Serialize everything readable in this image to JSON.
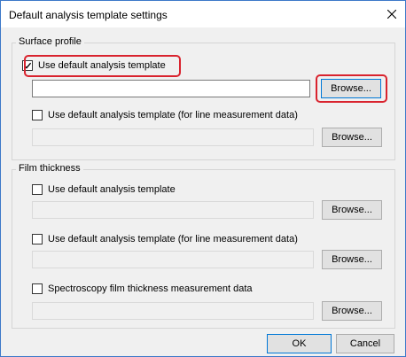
{
  "dialog": {
    "title": "Default analysis template settings",
    "close_icon": "close-icon"
  },
  "surface_profile": {
    "legend": "Surface profile",
    "default_template": {
      "checked": true,
      "label": "Use default analysis template",
      "path_value": "",
      "browse_label": "Browse..."
    },
    "line_template": {
      "checked": false,
      "label": "Use default analysis template (for line measurement data)",
      "path_value": "",
      "browse_label": "Browse..."
    }
  },
  "film_thickness": {
    "legend": "Film thickness",
    "default_template": {
      "checked": false,
      "label": "Use default analysis template",
      "path_value": "",
      "browse_label": "Browse..."
    },
    "line_template": {
      "checked": false,
      "label": "Use default analysis template (for line measurement data)",
      "path_value": "",
      "browse_label": "Browse..."
    },
    "spectroscopy": {
      "checked": false,
      "label": "Spectroscopy film thickness measurement data",
      "path_value": "",
      "browse_label": "Browse..."
    }
  },
  "footer": {
    "ok_label": "OK",
    "cancel_label": "Cancel"
  },
  "colors": {
    "highlight": "#d9232e",
    "window_border": "#3c78c8",
    "focus_border": "#0078d7"
  }
}
